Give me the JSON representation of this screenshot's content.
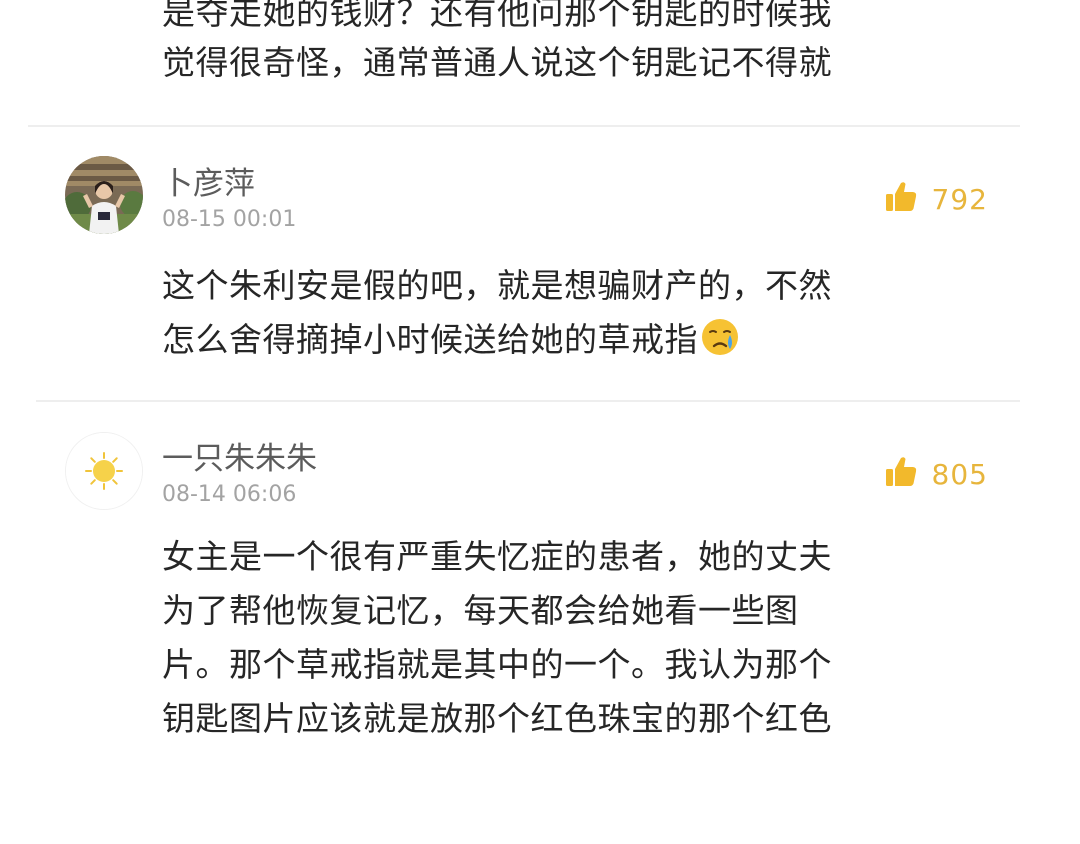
{
  "previous_comment": {
    "lines": [
      "是夺走她的钱财？还有他问那个钥匙的时候我",
      "觉得很奇怪，通常普通人说这个钥匙记不得就"
    ]
  },
  "comments": [
    {
      "username": "卜彦萍",
      "timestamp": "08-15 00:01",
      "likes": "792",
      "lines": [
        "这个朱利安是假的吧，就是想骗财产的，不然",
        "怎么舍得摘掉小时候送给她的草戒指"
      ],
      "emoji": "crying-face-emoji"
    },
    {
      "username": "一只朱朱朱",
      "timestamp": "08-14 06:06",
      "likes": "805",
      "lines": [
        "女主是一个很有严重失忆症的患者，她的丈夫",
        "为了帮他恢复记忆，每天都会给她看一些图",
        "片。那个草戒指就是其中的一个。我认为那个",
        "钥匙图片应该就是放那个红色珠宝的那个红色"
      ]
    }
  ],
  "colors": {
    "like_icon": "#f2b92c",
    "like_count": "#e7b53c",
    "username": "#5c5c5c",
    "timestamp": "#a3a3a3"
  }
}
